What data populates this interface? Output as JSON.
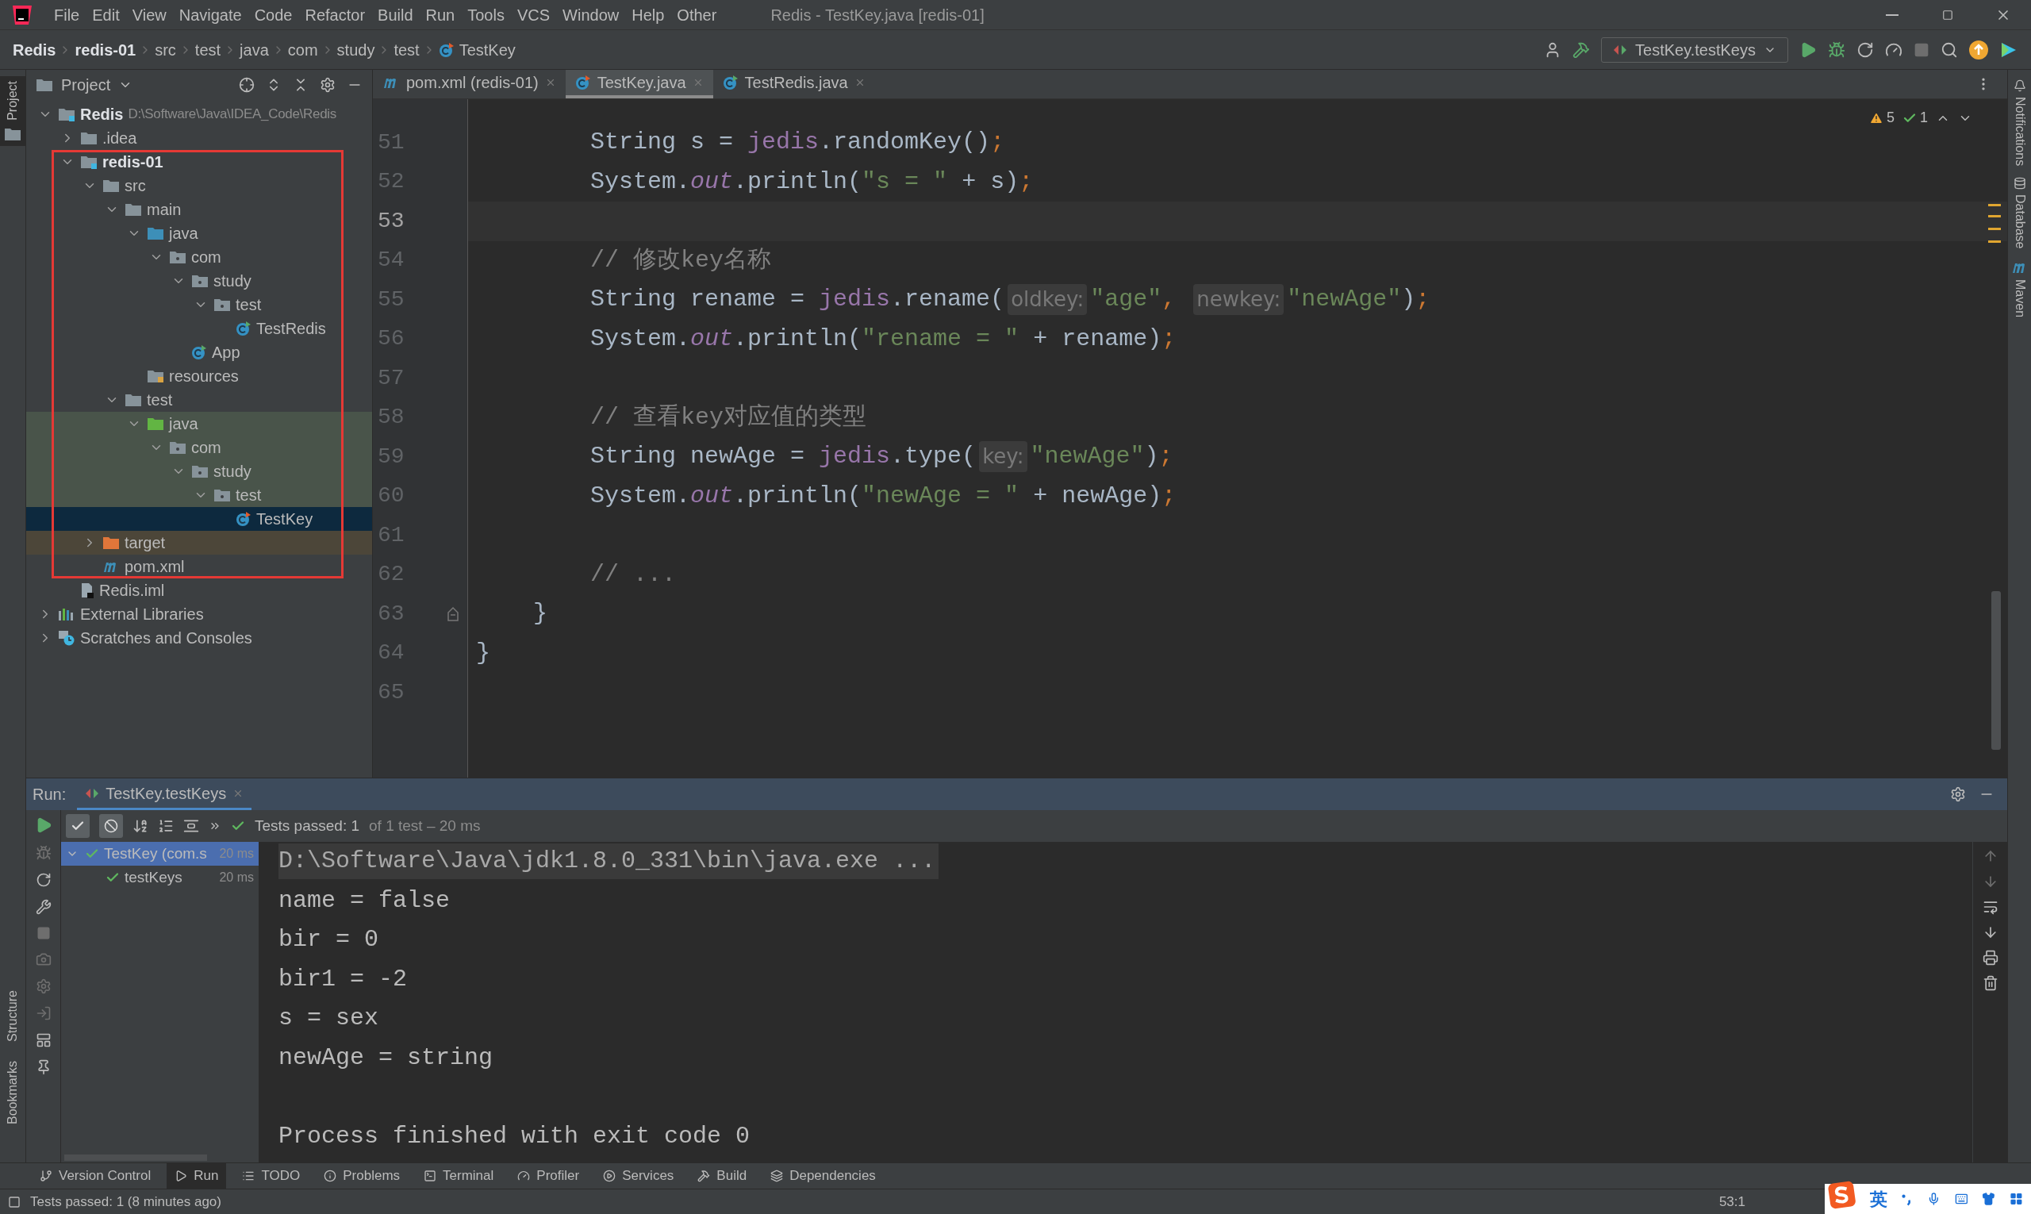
{
  "window": {
    "title": "Redis - TestKey.java [redis-01]"
  },
  "menu": [
    "File",
    "Edit",
    "View",
    "Navigate",
    "Code",
    "Refactor",
    "Build",
    "Run",
    "Tools",
    "VCS",
    "Window",
    "Help",
    "Other"
  ],
  "breadcrumb": [
    "Redis",
    "redis-01",
    "src",
    "test",
    "java",
    "com",
    "study",
    "test",
    "TestKey"
  ],
  "run_config": "TestKey.testKeys",
  "left_strip": {
    "top": [
      "Project"
    ],
    "bottom": [
      "Structure",
      "Bookmarks"
    ]
  },
  "right_strip": [
    "Notifications",
    "Database",
    "Maven"
  ],
  "project": {
    "title": "Project",
    "tree": [
      {
        "label": "Redis",
        "hint": "D:\\Software\\Java\\IDEA_Code\\Redis",
        "kind": "module",
        "bold": true,
        "expanded": true,
        "selected": false,
        "children": [
          {
            "label": ".idea",
            "kind": "folder",
            "expanded": false,
            "selected": false
          },
          {
            "label": "redis-01",
            "kind": "module",
            "bold": true,
            "expanded": true,
            "framed": true,
            "selected": false,
            "children": [
              {
                "label": "src",
                "kind": "folder",
                "expanded": true,
                "selected": false,
                "children": [
                  {
                    "label": "main",
                    "kind": "folder",
                    "expanded": true,
                    "selected": false,
                    "children": [
                      {
                        "label": "java",
                        "kind": "source",
                        "expanded": true,
                        "selected": false,
                        "children": [
                          {
                            "label": "com",
                            "kind": "package",
                            "expanded": true,
                            "selected": false,
                            "children": [
                              {
                                "label": "study",
                                "kind": "package",
                                "expanded": true,
                                "selected": false,
                                "children": [
                                  {
                                    "label": "test",
                                    "kind": "package",
                                    "expanded": true,
                                    "selected": false,
                                    "children": [
                                      {
                                        "label": "TestRedis",
                                        "kind": "class",
                                        "selected": false
                                      }
                                    ]
                                  }
                                ]
                              },
                              {
                                "label": "App",
                                "kind": "class",
                                "selected": false
                              }
                            ]
                          }
                        ]
                      },
                      {
                        "label": "resources",
                        "kind": "resources",
                        "selected": false
                      }
                    ]
                  },
                  {
                    "label": "test",
                    "kind": "folder",
                    "expanded": true,
                    "selected": false,
                    "children": [
                      {
                        "label": "java",
                        "kind": "test-source",
                        "in_test_root": true,
                        "expanded": true,
                        "selected": false,
                        "children": [
                          {
                            "label": "com",
                            "kind": "package",
                            "in_test_root": true,
                            "expanded": true,
                            "selected": false,
                            "children": [
                              {
                                "label": "study",
                                "kind": "package",
                                "in_test_root": true,
                                "expanded": true,
                                "selected": false,
                                "children": [
                                  {
                                    "label": "test",
                                    "kind": "package",
                                    "in_test_root": true,
                                    "expanded": true,
                                    "selected": false,
                                    "children": [
                                      {
                                        "label": "TestKey",
                                        "kind": "test-class",
                                        "in_test_root": true,
                                        "selected": true
                                      }
                                    ]
                                  }
                                ]
                              }
                            ]
                          }
                        ]
                      }
                    ]
                  }
                ]
              },
              {
                "label": "target",
                "kind": "excluded",
                "excluded": true,
                "expanded": false,
                "selected": false
              },
              {
                "label": "pom.xml",
                "kind": "maven",
                "selected": false
              }
            ]
          },
          {
            "label": "Redis.iml",
            "kind": "iml",
            "selected": false
          }
        ]
      },
      {
        "label": "External Libraries",
        "kind": "libraries",
        "expanded": false,
        "selected": false
      },
      {
        "label": "Scratches and Consoles",
        "kind": "scratches",
        "expanded": false,
        "selected": false
      }
    ]
  },
  "editor": {
    "tabs": [
      {
        "label": "pom.xml (redis-01)",
        "kind": "maven",
        "selected": false
      },
      {
        "label": "TestKey.java",
        "kind": "test-class",
        "selected": true
      },
      {
        "label": "TestRedis.java",
        "kind": "class",
        "selected": false
      }
    ],
    "warnings": "5",
    "checks": "1",
    "lines": [
      {
        "number": "51",
        "current": false,
        "tokens": [
          {
            "kind": "plain",
            "text": "        String s = "
          },
          {
            "kind": "field",
            "text": "jedis"
          },
          {
            "kind": "plain",
            "text": ".randomKey()"
          },
          {
            "kind": "punct",
            "text": ";"
          }
        ]
      },
      {
        "number": "52",
        "current": false,
        "tokens": [
          {
            "kind": "plain",
            "text": "        System."
          },
          {
            "kind": "static",
            "text": "out"
          },
          {
            "kind": "plain",
            "text": ".println("
          },
          {
            "kind": "string",
            "text": "\"s = \""
          },
          {
            "kind": "plain",
            "text": " + s)"
          },
          {
            "kind": "punct",
            "text": ";"
          }
        ]
      },
      {
        "number": "53",
        "current": true
      },
      {
        "number": "54",
        "current": false,
        "tokens": [
          {
            "kind": "comment",
            "text": "        // 修改key名称"
          }
        ]
      },
      {
        "number": "55",
        "current": false,
        "tokens": [
          {
            "kind": "plain",
            "text": "        String rename = "
          },
          {
            "kind": "field",
            "text": "jedis"
          },
          {
            "kind": "plain",
            "text": ".rename("
          },
          {
            "kind": "hint",
            "text": "oldkey:"
          },
          {
            "kind": "string",
            "text": "\"age\""
          },
          {
            "kind": "punct",
            "text": ", "
          },
          {
            "kind": "hint",
            "text": "newkey:"
          },
          {
            "kind": "string",
            "text": "\"newAge\""
          },
          {
            "kind": "plain",
            "text": ")"
          },
          {
            "kind": "punct",
            "text": ";"
          }
        ]
      },
      {
        "number": "56",
        "current": false,
        "tokens": [
          {
            "kind": "plain",
            "text": "        System."
          },
          {
            "kind": "static",
            "text": "out"
          },
          {
            "kind": "plain",
            "text": ".println("
          },
          {
            "kind": "string",
            "text": "\"rename = \""
          },
          {
            "kind": "plain",
            "text": " + rename)"
          },
          {
            "kind": "punct",
            "text": ";"
          }
        ]
      },
      {
        "number": "57",
        "current": false
      },
      {
        "number": "58",
        "current": false,
        "tokens": [
          {
            "kind": "comment",
            "text": "        // 查看key对应值的类型"
          }
        ]
      },
      {
        "number": "59",
        "current": false,
        "tokens": [
          {
            "kind": "plain",
            "text": "        String newAge = "
          },
          {
            "kind": "field",
            "text": "jedis"
          },
          {
            "kind": "plain",
            "text": ".type("
          },
          {
            "kind": "hint",
            "text": "key:"
          },
          {
            "kind": "string",
            "text": "\"newAge\""
          },
          {
            "kind": "plain",
            "text": ")"
          },
          {
            "kind": "punct",
            "text": ";"
          }
        ]
      },
      {
        "number": "60",
        "current": false,
        "tokens": [
          {
            "kind": "plain",
            "text": "        System."
          },
          {
            "kind": "static",
            "text": "out"
          },
          {
            "kind": "plain",
            "text": ".println("
          },
          {
            "kind": "string",
            "text": "\"newAge = \""
          },
          {
            "kind": "plain",
            "text": " + newAge)"
          },
          {
            "kind": "punct",
            "text": ";"
          }
        ]
      },
      {
        "number": "61",
        "current": false
      },
      {
        "number": "62",
        "current": false,
        "tokens": [
          {
            "kind": "comment",
            "text": "        // ..."
          }
        ]
      },
      {
        "number": "63",
        "current": false,
        "fold": true,
        "tokens": [
          {
            "kind": "plain",
            "text": "    }"
          }
        ]
      },
      {
        "number": "64",
        "current": false,
        "tokens": [
          {
            "kind": "plain",
            "text": "}"
          }
        ]
      },
      {
        "number": "65",
        "current": false
      }
    ]
  },
  "run": {
    "label": "Run:",
    "tab": "TestKey.testKeys",
    "status": "Tests passed: 1",
    "status_detail": "of 1 test – 20 ms",
    "tests": [
      {
        "label": "TestKey (com.s",
        "time": "20 ms",
        "passed": true,
        "selected": true,
        "expanded": true,
        "children": [
          {
            "label": "testKeys",
            "time": "20 ms",
            "passed": true,
            "selected": false
          }
        ]
      }
    ],
    "console": [
      {
        "kind": "command",
        "text": "D:\\Software\\Java\\jdk1.8.0_331\\bin\\java.exe ..."
      },
      {
        "kind": "output",
        "text": "name = false"
      },
      {
        "kind": "output",
        "text": "bir = 0"
      },
      {
        "kind": "output",
        "text": "bir1 = -2"
      },
      {
        "kind": "output",
        "text": "s = sex"
      },
      {
        "kind": "output",
        "text": "newAge = string"
      },
      {
        "kind": "exit",
        "text": "Process finished with exit code 0"
      }
    ]
  },
  "tool_windows": [
    {
      "label": "Version Control",
      "selected": false
    },
    {
      "label": "Run",
      "selected": true
    },
    {
      "label": "TODO",
      "selected": false
    },
    {
      "label": "Problems",
      "selected": false
    },
    {
      "label": "Terminal",
      "selected": false
    },
    {
      "label": "Profiler",
      "selected": false
    },
    {
      "label": "Services",
      "selected": false
    },
    {
      "label": "Build",
      "selected": false
    },
    {
      "label": "Dependencies",
      "selected": false
    }
  ],
  "status_bar": {
    "message": "Tests passed: 1 (8 minutes ago)",
    "position": "53:1",
    "ime": "英"
  }
}
